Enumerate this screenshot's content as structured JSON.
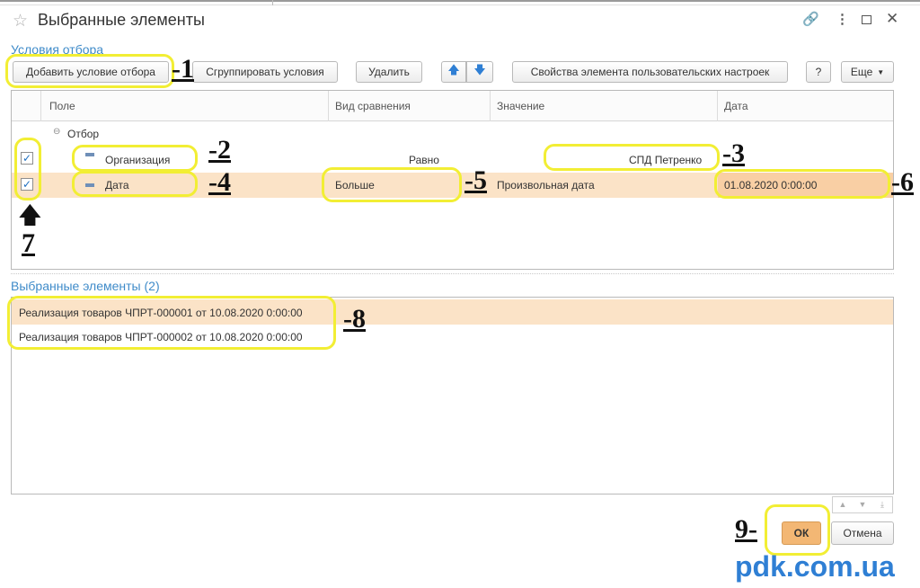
{
  "window": {
    "title": "Выбранные элементы",
    "star_icon": "star-icon"
  },
  "conditions": {
    "section_title": "Условия отбора"
  },
  "toolbar": {
    "add_condition": "Добавить условие отбора",
    "group_conditions": "Сгруппировать условия",
    "delete": "Удалить",
    "up_arrow": "🡅",
    "down_arrow": "🡇",
    "user_settings_props": "Свойства элемента пользовательских настроек",
    "help": "?",
    "more": "Еще"
  },
  "filter_table": {
    "headers": [
      "Поле",
      "Вид сравнения",
      "Значение",
      "Дата"
    ],
    "group_label": "Отбор",
    "rows": [
      {
        "field": "Организация",
        "comparison": "Равно",
        "value": "СПД Петренко",
        "date": "",
        "checked": true
      },
      {
        "field": "Дата",
        "comparison": "Больше",
        "value": "Произвольная дата",
        "date": "01.08.2020 0:00:00",
        "checked": true
      }
    ]
  },
  "selected": {
    "title": "Выбранные элементы (2)",
    "items": [
      "Реализация товаров ЧПРТ-000001 от 10.08.2020 0:00:00",
      "Реализация товаров ЧПРТ-000002 от 10.08.2020 0:00:00"
    ]
  },
  "footer": {
    "ok": "ОК",
    "cancel": "Отмена"
  },
  "annotations": {
    "a1": "-1",
    "a2": "-2",
    "a3": "-3",
    "a4": "-4",
    "a5": "-5",
    "a6": "-6",
    "a7": "7",
    "a8": "-8",
    "a9": "9-"
  },
  "watermark": "pdk.com.ua",
  "colors": {
    "accent": "#3f8bc9",
    "highlight": "#f2ee34",
    "selected_row": "#fbe3c7",
    "ok_button": "#f3b774"
  }
}
